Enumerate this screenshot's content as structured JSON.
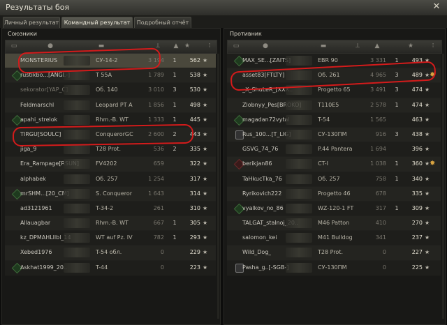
{
  "window": {
    "title": "Результаты боя"
  },
  "tabs": [
    {
      "label": "Личный результат"
    },
    {
      "label": "Командный результат"
    },
    {
      "label": "Подробный отчёт"
    }
  ],
  "allies": {
    "title": "Союзники",
    "rows": [
      {
        "name": "MONSTERIUS",
        "tank": "СУ-14-2",
        "damage": "3 194",
        "frags": "1",
        "xp": "562",
        "self": true
      },
      {
        "name": "rustikbo...[ANGL-]",
        "tank": "T 55A",
        "damage": "1 789",
        "frags": "1",
        "xp": "538",
        "badge": "green"
      },
      {
        "name": "sekorator[YAP_C]",
        "tank": "Об. 140",
        "damage": "3 010",
        "frags": "3",
        "xp": "530",
        "dead": true
      },
      {
        "name": "Feldmarschl",
        "tank": "Leopard PT A",
        "damage": "1 856",
        "frags": "1",
        "xp": "498"
      },
      {
        "name": "apahi_strelok",
        "tank": "Rhm.-B. WT",
        "damage": "1 333",
        "frags": "1",
        "xp": "445",
        "badge": "green"
      },
      {
        "name": "TIRGU[SOULC]",
        "tank": "ConquerorGC",
        "damage": "2 600",
        "frags": "2",
        "xp": "443"
      },
      {
        "name": "jiga_9",
        "tank": "T28 Prot.",
        "damage": "536",
        "frags": "2",
        "xp": "335"
      },
      {
        "name": "Era_Rampage[RSUN]",
        "tank": "FV4202",
        "damage": "659",
        "frags": "",
        "xp": "322"
      },
      {
        "name": "alphabek",
        "tank": "Об. 257",
        "damage": "1 254",
        "frags": "",
        "xp": "317"
      },
      {
        "name": "mrSHM...[20_CM]",
        "tank": "S. Conqueror",
        "damage": "1 643",
        "frags": "",
        "xp": "314",
        "badge": "green"
      },
      {
        "name": "ad3121961",
        "tank": "T-34-2",
        "damage": "261",
        "frags": "",
        "xp": "310"
      },
      {
        "name": "Allauagbar",
        "tank": "Rhm.-B. WT",
        "damage": "667",
        "frags": "1",
        "xp": "305"
      },
      {
        "name": "kz_DPMAHLllbl_14",
        "tank": "WT auf Pz. IV",
        "damage": "782",
        "frags": "1",
        "xp": "293"
      },
      {
        "name": "Xebed1976",
        "tank": "T-54 обл.",
        "damage": "0",
        "frags": "",
        "xp": "229"
      },
      {
        "name": "Askhat1999_20..",
        "tank": "T-44",
        "damage": "0",
        "frags": "",
        "xp": "223",
        "badge": "green"
      }
    ]
  },
  "enemies": {
    "title": "Противник",
    "rows": [
      {
        "name": "MAX_SE...[ZAITS]",
        "tank": "EBR 90",
        "damage": "3 331",
        "frags": "1",
        "xp": "493",
        "badge": "green"
      },
      {
        "name": "asset83[FTLTY]",
        "tank": "Об. 261",
        "damage": "4 965",
        "frags": "3",
        "xp": "489",
        "medal": true
      },
      {
        "name": "_X_ShuLeR_[XXX..",
        "tank": "Progetto 65",
        "damage": "3 491",
        "frags": "3",
        "xp": "474"
      },
      {
        "name": "Zlobnyy_Pes[BROKO]",
        "tank": "T110E5",
        "damage": "2 578",
        "frags": "1",
        "xp": "474"
      },
      {
        "name": "magadan72vytal",
        "tank": "T-54",
        "damage": "1 565",
        "frags": "",
        "xp": "463",
        "badge": "green"
      },
      {
        "name": "Rus_100...[T_LIG]",
        "tank": "СУ-130ПМ",
        "damage": "916",
        "frags": "3",
        "xp": "438",
        "badge": "silver",
        "alive": true
      },
      {
        "name": "GSVG_74_76",
        "tank": "P.44 Pantera",
        "damage": "1 694",
        "frags": "",
        "xp": "396"
      },
      {
        "name": "berikjan86",
        "tank": "CT-I",
        "damage": "1 038",
        "frags": "1",
        "xp": "360",
        "badge": "dot",
        "alive": true,
        "medal": true
      },
      {
        "name": "TaHkucTka_76",
        "tank": "Об. 257",
        "damage": "758",
        "frags": "1",
        "xp": "340"
      },
      {
        "name": "Ryrikovich222",
        "tank": "Progetto 46",
        "damage": "678",
        "frags": "",
        "xp": "335"
      },
      {
        "name": "vyalkov_no_86",
        "tank": "WZ-120-1 FT",
        "damage": "317",
        "frags": "1",
        "xp": "309",
        "badge": "green"
      },
      {
        "name": "TALGAT_stalnoj_20..",
        "tank": "M46 Patton",
        "damage": "410",
        "frags": "",
        "xp": "270"
      },
      {
        "name": "salomon_kei",
        "tank": "M41 Bulldog",
        "damage": "341",
        "frags": "",
        "xp": "237"
      },
      {
        "name": "Wild_Dog_",
        "tank": "T28 Prot.",
        "damage": "0",
        "frags": "",
        "xp": "227"
      },
      {
        "name": "Pasha_g..[-SGB-]",
        "tank": "СУ-130ПМ",
        "damage": "0",
        "frags": "",
        "xp": "225",
        "badge": "silver",
        "alive": true
      }
    ]
  },
  "star_glyph": "★",
  "medal_glyph": "✸",
  "annotation_color": "#d41b1b"
}
